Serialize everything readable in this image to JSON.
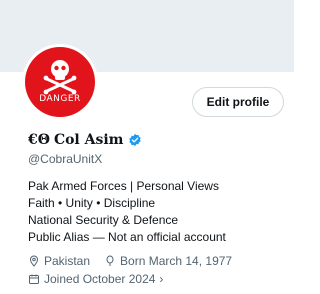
{
  "profile": {
    "avatar_text": "DANGER",
    "edit_label": "Edit profile",
    "name_logo": "€Θ",
    "name": "Col Asim",
    "handle": "@CobraUnitX",
    "bio": [
      "Pak Armed Forces | Personal Views",
      "Faith • Unity • Discipline",
      "National Security & Defence",
      "Public Alias — Not an official account"
    ],
    "location": "Pakistan",
    "born": "Born March 14, 1977",
    "joined": "Joined October 2024",
    "joined_chevron": "›"
  },
  "icons": {
    "verified": "verified-badge-icon",
    "location": "location-pin-icon",
    "birthday": "balloon-icon",
    "calendar": "calendar-icon"
  },
  "colors": {
    "avatar_bg": "#e2141b",
    "verified": "#1d9bf0",
    "muted_text": "#536471",
    "text": "#0f1419"
  }
}
